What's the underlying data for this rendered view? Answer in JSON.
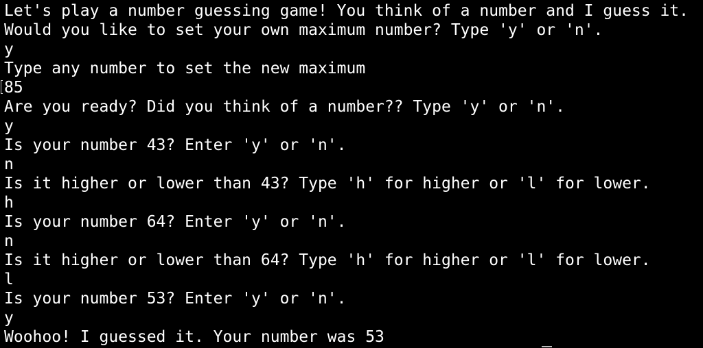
{
  "terminal": {
    "lines": [
      "Let's play a number guessing game! You think of a number and I guess it.",
      "Would you like to set your own maximum number? Type 'y' or 'n'.",
      "y",
      "Type any number to set the new maximum",
      "85",
      "Are you ready? Did you think of a number?? Type 'y' or 'n'.",
      "y",
      "Is your number 43? Enter 'y' or 'n'.",
      "n",
      "Is it higher or lower than 43? Type 'h' for higher or 'l' for lower.",
      "h",
      "Is your number 64? Enter 'y' or 'n'.",
      "n",
      "Is it higher or lower than 64? Type 'h' for higher or 'l' for lower.",
      "l",
      "Is your number 53? Enter 'y' or 'n'.",
      "y",
      "Woohoo! I guessed it. Your number was 53"
    ]
  },
  "colors": {
    "background": "#000000",
    "text": "#ffffff"
  }
}
